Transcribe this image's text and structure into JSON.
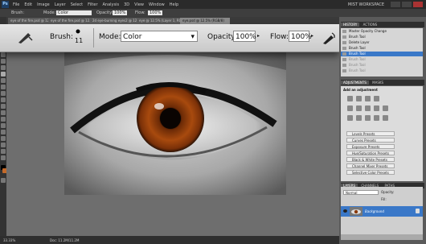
{
  "app": {
    "logo": "Ps",
    "workspace": "MIST WORKSPACE"
  },
  "menu": [
    "File",
    "Edit",
    "Image",
    "Layer",
    "Select",
    "Filter",
    "Analysis",
    "3D",
    "View",
    "Window",
    "Help"
  ],
  "options_small": {
    "brush_label": "Brush:",
    "mode_label": "Mode:",
    "mode_value": "Color",
    "opacity_label": "Opacity:",
    "opacity_value": "100%",
    "flow_label": "Flow:",
    "flow_value": "100%"
  },
  "options_large": {
    "brush_label": "Brush:",
    "brush_size": "11",
    "mode_label": "Mode:",
    "mode_value": "Color",
    "opacity_label": "Opacity:",
    "opacity_value": "100%",
    "flow_label": "Flow:",
    "flow_value": "100%"
  },
  "tabs": [
    "eye of the fire.psd @ 12.5% (RGB/8)",
    "eye of the fire.psd @ 12.5% (RGB/8)",
    "2d eye-burning eyes2 @ 12.5% (RGB/8)",
    "eye @ 12.5% (Layer 1, RGB/8)",
    "eye.psd @ 12.5% (RGB/8)"
  ],
  "status": {
    "zoom": "33.33%",
    "doc": "Doc: 11.2M/11.2M"
  },
  "history": {
    "tabs": [
      "HISTORY",
      "ACTIONS"
    ],
    "items": [
      {
        "label": "Master Opacity Change",
        "state": "normal"
      },
      {
        "label": "Brush Tool",
        "state": "normal"
      },
      {
        "label": "Delete Layer",
        "state": "normal"
      },
      {
        "label": "Brush Tool",
        "state": "normal"
      },
      {
        "label": "Brush Tool",
        "state": "active"
      },
      {
        "label": "Brush Tool",
        "state": "undone"
      },
      {
        "label": "Brush Tool",
        "state": "undone"
      },
      {
        "label": "Brush Tool",
        "state": "undone"
      },
      {
        "label": "Brush Tool",
        "state": "undone"
      }
    ]
  },
  "adjustments": {
    "tabs": [
      "ADJUSTMENTS",
      "MASKS"
    ],
    "title": "Add an adjustment",
    "presets": [
      "Levels Presets",
      "Curves Presets",
      "Exposure Presets",
      "Hue/Saturation Presets",
      "Black & White Presets",
      "Channel Mixer Presets",
      "Selective Color Presets"
    ]
  },
  "layers": {
    "tabs": [
      "LAYERS",
      "CHANNELS",
      "PATHS"
    ],
    "blend_mode": "Normal",
    "opacity_label": "Opacity:",
    "fill_label": "Fill:",
    "layer_name": "Background"
  },
  "colors": {
    "accent": "#3a78c8",
    "iris": "#8a3a0a"
  }
}
